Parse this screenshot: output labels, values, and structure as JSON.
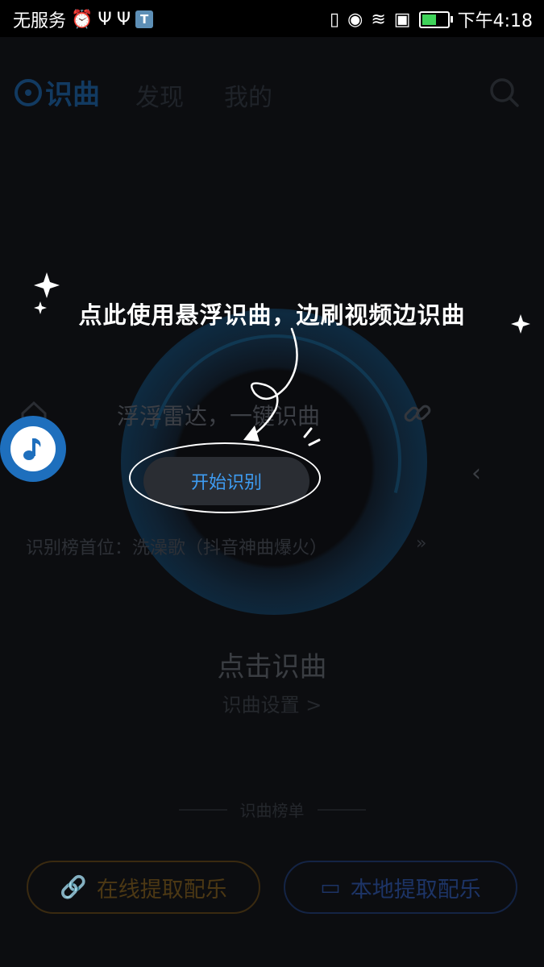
{
  "status_bar": {
    "carrier": "无服务",
    "app_badge": "T",
    "time": "下午4:18"
  },
  "header": {
    "tabs": [
      {
        "label": "识曲",
        "active": true
      },
      {
        "label": "发现",
        "active": false
      },
      {
        "label": "我的",
        "active": false
      }
    ]
  },
  "tutorial": {
    "tip": "点此使用悬浮识曲，边刷视频边识曲"
  },
  "float_panel": {
    "radar_label": "浮浮雷达，一键识曲",
    "start_button": "开始识别",
    "rank_text": "识别榜首位：洗澡歌（抖音神曲爆火）",
    "rank_arrow": "»",
    "collapse": "‹"
  },
  "main": {
    "tap_title": "点击识曲",
    "tap_sub": "识曲设置 >",
    "divider_text": "识曲榜单"
  },
  "actions": {
    "online": "在线提取配乐",
    "local": "本地提取配乐"
  },
  "colors": {
    "accent_blue": "#3e9cf2",
    "float_ball": "#1e6fbd",
    "background": "#0c0d10"
  }
}
